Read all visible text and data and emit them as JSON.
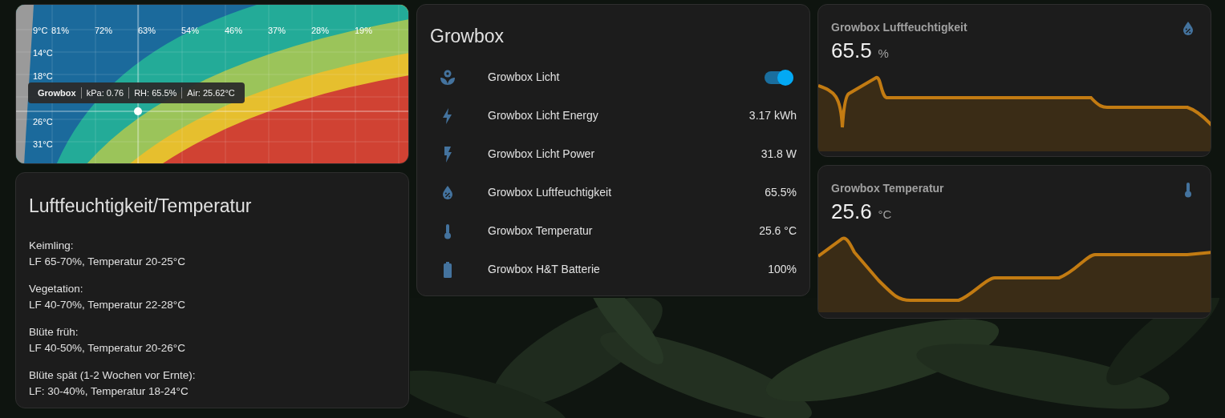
{
  "vpd_card": {
    "humidity_labels": [
      "81%",
      "72%",
      "63%",
      "54%",
      "46%",
      "37%",
      "28%",
      "19%"
    ],
    "temperature_labels": [
      "9°C",
      "14°C",
      "18°C",
      "26°C",
      "31°C"
    ],
    "tooltip": {
      "name": "Growbox",
      "parts": [
        "kPa: 0.76",
        "RH: 65.5%",
        "Air: 25.62°C"
      ]
    }
  },
  "info_card": {
    "title": "Luftfeuchtigkeit/Temperatur",
    "paragraphs": [
      {
        "label": "Keimling:",
        "text": "LF 65-70%, Temperatur 20-25°C"
      },
      {
        "label": "Vegetation:",
        "text": "LF 40-70%, Temperatur 22-28°C"
      },
      {
        "label": "Blüte früh:",
        "text": "LF 40-50%, Temperatur 20-26°C"
      },
      {
        "label": "Blüte spät (1-2 Wochen vor Ernte):",
        "text": "LF: 30-40%, Temperatur 18-24°C"
      }
    ]
  },
  "entities_card": {
    "title": "Growbox",
    "rows": [
      {
        "kind": "toggle",
        "name": "Growbox Licht",
        "on": true
      },
      {
        "kind": "sensor",
        "name": "Growbox Licht Energy",
        "value": "3.17 kWh"
      },
      {
        "kind": "sensor",
        "name": "Growbox Licht Power",
        "value": "31.8 W"
      },
      {
        "kind": "sensor",
        "name": "Growbox Luftfeuchtigkeit",
        "value": "65.5%"
      },
      {
        "kind": "sensor",
        "name": "Growbox Temperatur",
        "value": "25.6 °C"
      },
      {
        "kind": "sensor",
        "name": "Growbox H&T Batterie",
        "value": "100%"
      }
    ]
  },
  "sensor_cards": [
    {
      "name": "Growbox Luftfeuchtigkeit",
      "value": "65.5",
      "unit": "%"
    },
    {
      "name": "Growbox Temperatur",
      "value": "25.6",
      "unit": "°C"
    }
  ]
}
